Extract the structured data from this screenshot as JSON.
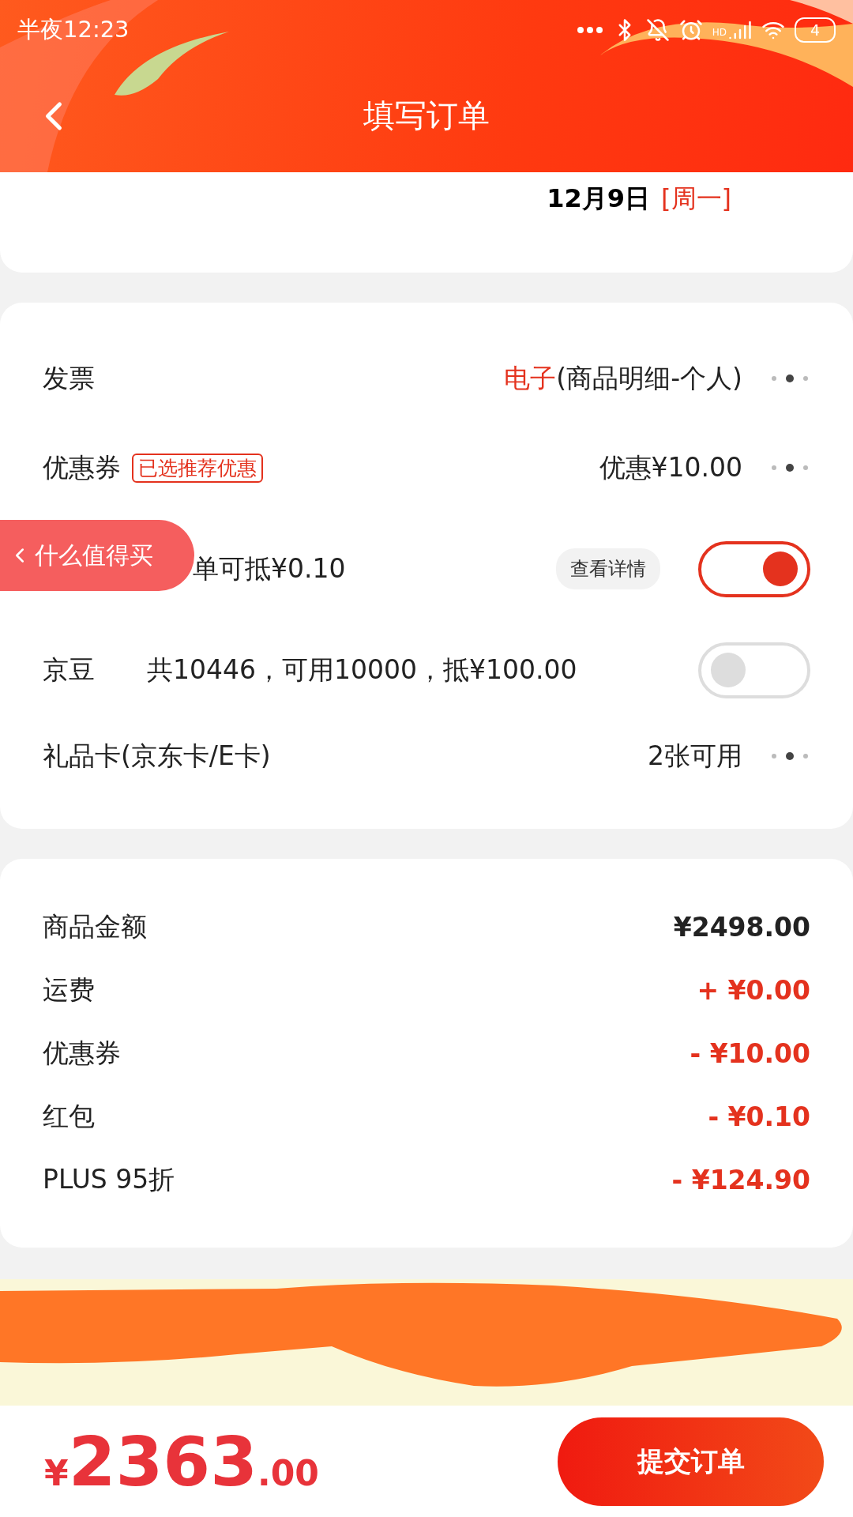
{
  "status_bar": {
    "time": "半夜12:23",
    "signal_label": "HD",
    "battery": "4"
  },
  "header": {
    "title": "填写订单"
  },
  "delivery": {
    "date": "12月9日",
    "weekday": "[周一]"
  },
  "options": [
    {
      "kind": "link",
      "label": "发票",
      "value_highlight": "电子",
      "value": "(商品明细-个人)"
    },
    {
      "kind": "link",
      "label": "优惠券",
      "tag": "已选推荐优惠",
      "value": "优惠¥10.00"
    },
    {
      "kind": "toggle",
      "value": "单可抵¥0.10",
      "detail_button": "查看详情",
      "on": true
    },
    {
      "kind": "toggle",
      "label": "京豆",
      "value": "共10446，可用10000，抵¥100.00",
      "on": false
    },
    {
      "kind": "link",
      "label": "礼品卡(京东卡/E卡)",
      "value": "2张可用"
    }
  ],
  "floating_pill": {
    "label": "什么值得买"
  },
  "summary": [
    {
      "kind": "base",
      "label": "商品金额",
      "amount": "¥2498.00"
    },
    {
      "kind": "adjustment",
      "label": "运费",
      "amount": "+ ¥0.00"
    },
    {
      "kind": "adjustment",
      "label": "优惠券",
      "amount": "- ¥10.00"
    },
    {
      "kind": "adjustment",
      "label": "红包",
      "amount": "- ¥0.10"
    },
    {
      "kind": "adjustment",
      "label": "PLUS 95折",
      "amount": "- ¥124.90"
    }
  ],
  "footer": {
    "currency": "¥",
    "price_integer": "2363",
    "price_decimal": ".00",
    "submit_button": "提交订单"
  }
}
